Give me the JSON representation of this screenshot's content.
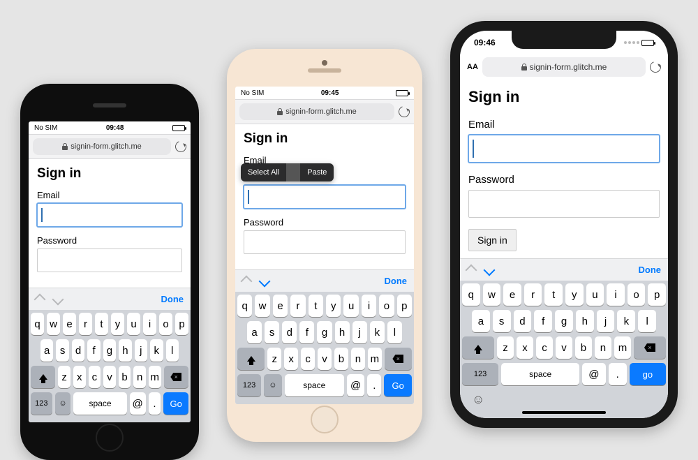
{
  "url": "signin-form.glitch.me",
  "page": {
    "heading": "Sign in",
    "email_label": "Email",
    "password_label": "Password",
    "submit_label": "Sign in"
  },
  "status": {
    "carrier_none": "No SIM",
    "time_p1": "09:48",
    "time_p2": "09:45",
    "time_p3": "09:46"
  },
  "ctx": {
    "select_all": "Select All",
    "paste": "Paste"
  },
  "kb": {
    "done": "Done",
    "row1": [
      "q",
      "w",
      "e",
      "r",
      "t",
      "y",
      "u",
      "i",
      "o",
      "p"
    ],
    "row2": [
      "a",
      "s",
      "d",
      "f",
      "g",
      "h",
      "j",
      "k",
      "l"
    ],
    "row3": [
      "z",
      "x",
      "c",
      "v",
      "b",
      "n",
      "m"
    ],
    "n123": "123",
    "space": "space",
    "at": "@",
    "dot": ".",
    "go_cap": "Go",
    "go_low": "go",
    "aa": "AA"
  }
}
